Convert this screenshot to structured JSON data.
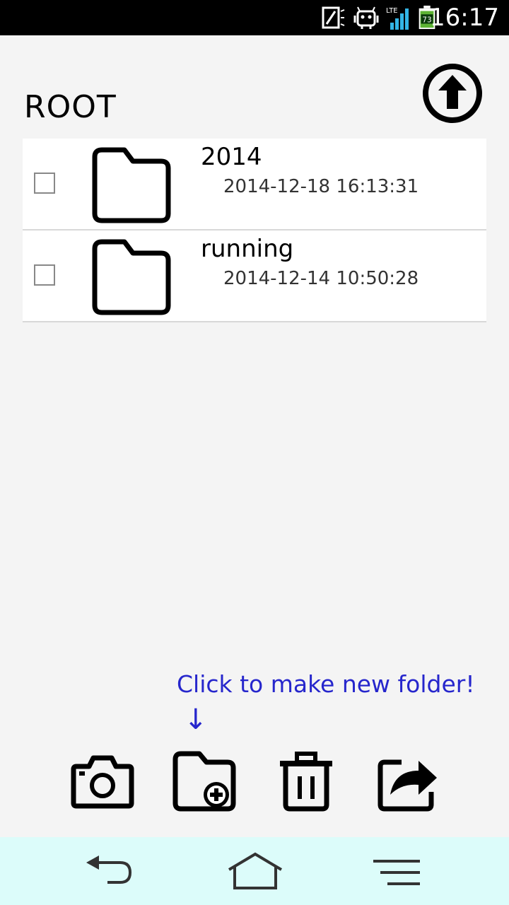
{
  "status_bar": {
    "time": "16:17",
    "battery_level": "73",
    "network_label": "LTE",
    "icons": [
      "sim-icon",
      "android-icon",
      "signal-icon",
      "battery-icon"
    ]
  },
  "header": {
    "title": "ROOT",
    "up_icon": "arrow-up-circle-icon"
  },
  "files": [
    {
      "name": "2014",
      "date": "2014-12-18 16:13:31",
      "icon": "folder-icon",
      "checked": false
    },
    {
      "name": "running",
      "date": "2014-12-14 10:50:28",
      "icon": "folder-icon",
      "checked": false
    }
  ],
  "hint": {
    "text": "Click to make new folder!",
    "arrow": "↓",
    "color": "#2626cc"
  },
  "toolbar": {
    "buttons": [
      "camera-icon",
      "new-folder-icon",
      "trash-icon",
      "share-icon"
    ]
  },
  "nav_bar": {
    "background": "#dcfcfa",
    "buttons": [
      "back-icon",
      "home-icon",
      "menu-icon"
    ]
  }
}
